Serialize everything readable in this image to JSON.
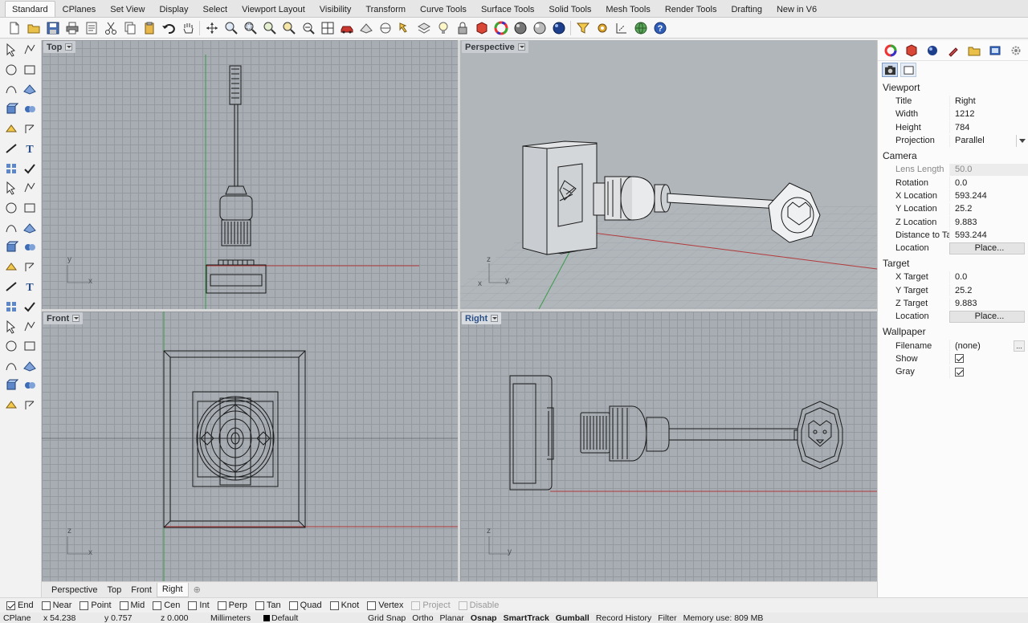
{
  "ribbon": {
    "tabs": [
      "Standard",
      "CPlanes",
      "Set View",
      "Display",
      "Select",
      "Viewport Layout",
      "Visibility",
      "Transform",
      "Curve Tools",
      "Surface Tools",
      "Solid Tools",
      "Mesh Tools",
      "Render Tools",
      "Drafting",
      "New in V6"
    ],
    "active": "Standard"
  },
  "viewports": {
    "top": {
      "title": "Top",
      "axis_y": "y",
      "axis_x": "x"
    },
    "perspective": {
      "title": "Perspective",
      "axis_z": "z",
      "axis_y": "y",
      "axis_x": "x"
    },
    "front": {
      "title": "Front",
      "axis_z": "z",
      "axis_x": "x"
    },
    "right": {
      "title": "Right",
      "axis_z": "z",
      "axis_y": "y"
    }
  },
  "viewport_tabs": [
    "Perspective",
    "Top",
    "Front",
    "Right"
  ],
  "active_viewport_tab": "Right",
  "panel": {
    "viewport": {
      "heading": "Viewport",
      "title_label": "Title",
      "title": "Right",
      "width_label": "Width",
      "width": "1212",
      "height_label": "Height",
      "height": "784",
      "projection_label": "Projection",
      "projection": "Parallel"
    },
    "camera": {
      "heading": "Camera",
      "lens_length_label": "Lens Length",
      "lens_length": "50.0",
      "rotation_label": "Rotation",
      "rotation": "0.0",
      "x_location_label": "X Location",
      "x_location": "593.244",
      "y_location_label": "Y Location",
      "y_location": "25.2",
      "z_location_label": "Z Location",
      "z_location": "9.883",
      "distance_label": "Distance to Ta...",
      "distance": "593.244",
      "location_label": "Location",
      "location_button": "Place..."
    },
    "target": {
      "heading": "Target",
      "x_target_label": "X Target",
      "x_target": "0.0",
      "y_target_label": "Y Target",
      "y_target": "25.2",
      "z_target_label": "Z Target",
      "z_target": "9.883",
      "location_label": "Location",
      "location_button": "Place..."
    },
    "wallpaper": {
      "heading": "Wallpaper",
      "filename_label": "Filename",
      "filename": "(none)",
      "filename_button": "...",
      "show_label": "Show",
      "show": true,
      "gray_label": "Gray",
      "gray": true
    }
  },
  "osnap": [
    {
      "label": "End",
      "checked": true,
      "enabled": true
    },
    {
      "label": "Near",
      "checked": false,
      "enabled": true
    },
    {
      "label": "Point",
      "checked": false,
      "enabled": true
    },
    {
      "label": "Mid",
      "checked": false,
      "enabled": true
    },
    {
      "label": "Cen",
      "checked": false,
      "enabled": true
    },
    {
      "label": "Int",
      "checked": false,
      "enabled": true
    },
    {
      "label": "Perp",
      "checked": false,
      "enabled": true
    },
    {
      "label": "Tan",
      "checked": false,
      "enabled": true
    },
    {
      "label": "Quad",
      "checked": false,
      "enabled": true
    },
    {
      "label": "Knot",
      "checked": false,
      "enabled": true
    },
    {
      "label": "Vertex",
      "checked": false,
      "enabled": true
    },
    {
      "label": "Project",
      "checked": false,
      "enabled": false
    },
    {
      "label": "Disable",
      "checked": false,
      "enabled": false
    }
  ],
  "status": {
    "cplane": "CPlane",
    "x": "x 54.238",
    "y": "y 0.757",
    "z": "z 0.000",
    "units": "Millimeters",
    "layer": "Default",
    "grid_snap": "Grid Snap",
    "ortho": "Ortho",
    "planar": "Planar",
    "osnap": "Osnap",
    "smarttrack": "SmartTrack",
    "gumball": "Gumball",
    "record_history": "Record History",
    "filter": "Filter",
    "memory": "Memory use: 809 MB"
  },
  "colors": {
    "viewport_bg": "#a7adb3",
    "grid": "#949aa0",
    "x_axis": "#b23a3a",
    "y_axis": "#3b9b4a",
    "active_title": "#2a4f86"
  }
}
